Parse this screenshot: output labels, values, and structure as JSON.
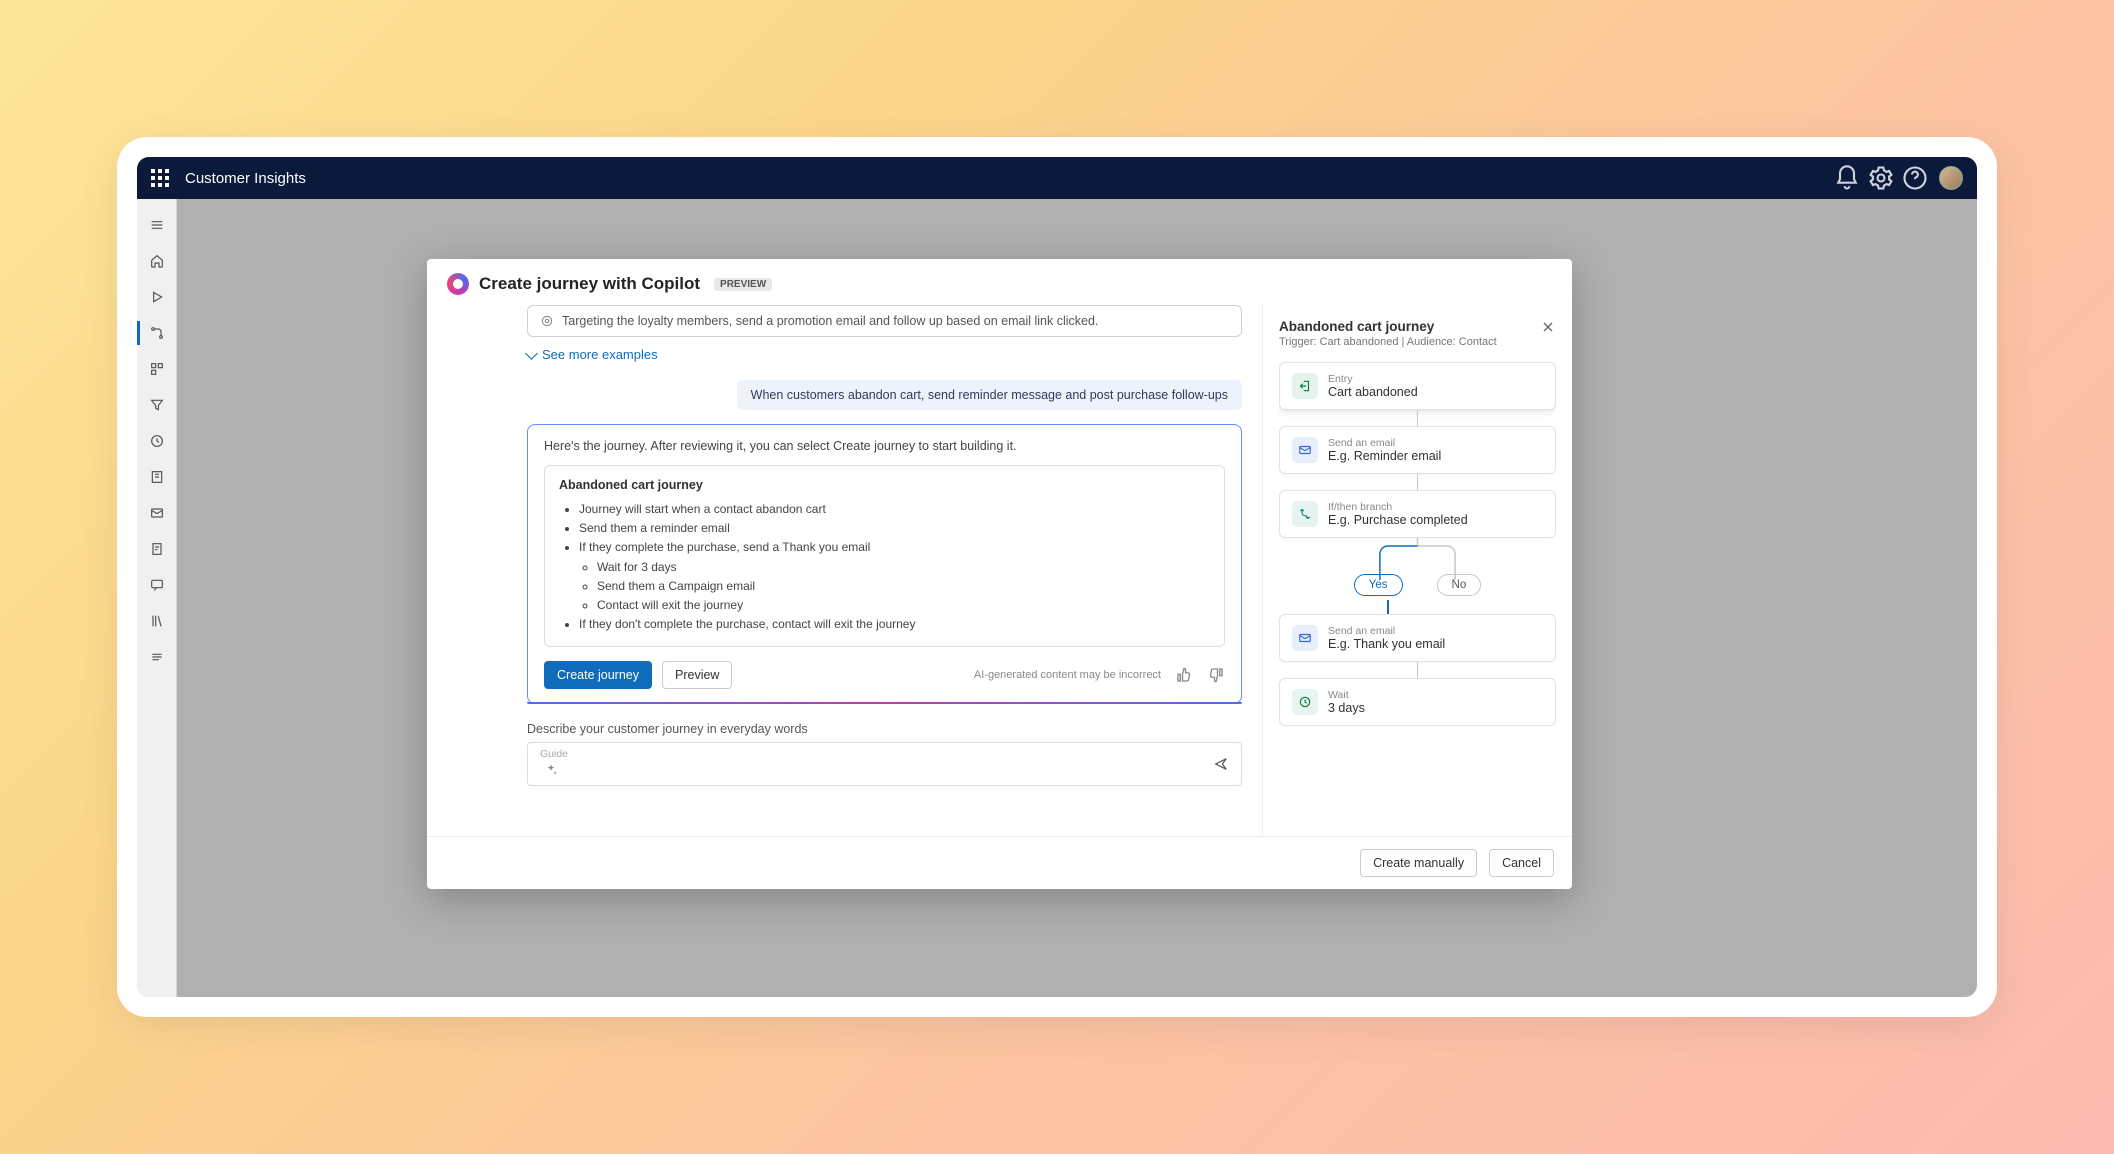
{
  "app": {
    "title": "Customer Insights"
  },
  "modal": {
    "title": "Create journey with Copilot",
    "badge": "PREVIEW",
    "example_pill": "Targeting the loyalty members, send a promotion email and follow up based on email link clicked.",
    "see_more": "See more examples",
    "user_message": "When customers abandon cart, send reminder message and post purchase follow-ups",
    "ai_intro": "Here's the journey. After reviewing it, you can select Create journey to start building it.",
    "summary_title": "Abandoned cart journey",
    "bullets": {
      "b1": "Journey will start when a contact abandon cart",
      "b2": "Send them a reminder email",
      "b3": "If they complete the purchase, send a Thank you email",
      "b3a": "Wait for 3 days",
      "b3b": "Send them a Campaign email",
      "b3c": "Contact will exit the journey",
      "b4": "If they don't complete the purchase, contact will exit the journey"
    },
    "create_btn": "Create journey",
    "preview_btn": "Preview",
    "disclaimer": "AI-generated content may be incorrect",
    "describe_label": "Describe your customer journey in everyday words",
    "guide_label": "Guide"
  },
  "preview": {
    "title": "Abandoned cart journey",
    "subtitle": "Trigger: Cart abandoned  |  Audience: Contact",
    "nodes": {
      "entry_label": "Entry",
      "entry_value": "Cart abandoned",
      "email1_label": "Send an email",
      "email1_value": "E.g. Reminder email",
      "branch_label": "If/then branch",
      "branch_value": "E.g. Purchase completed",
      "yes": "Yes",
      "no": "No",
      "email2_label": "Send an email",
      "email2_value": "E.g. Thank you email",
      "wait_label": "Wait",
      "wait_value": "3 days"
    }
  },
  "footer": {
    "manual": "Create manually",
    "cancel": "Cancel"
  }
}
